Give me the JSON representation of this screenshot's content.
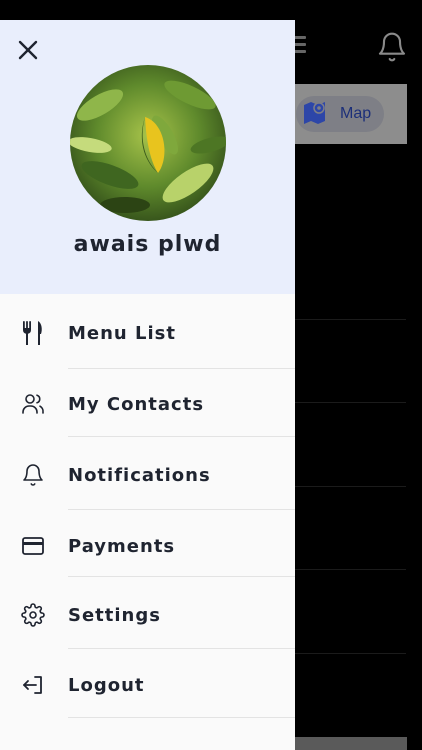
{
  "user": {
    "name": "awais plwd"
  },
  "background": {
    "map_label": "Map"
  },
  "menu": {
    "items": [
      {
        "label": "Menu List",
        "icon": "fork-knife-icon"
      },
      {
        "label": "My Contacts",
        "icon": "contacts-icon"
      },
      {
        "label": "Notifications",
        "icon": "bell-icon"
      },
      {
        "label": "Payments",
        "icon": "credit-card-icon"
      },
      {
        "label": "Settings",
        "icon": "gear-icon"
      },
      {
        "label": "Logout",
        "icon": "logout-icon"
      }
    ]
  },
  "colors": {
    "header_bg": "#e9eefc",
    "drawer_bg": "#fafafa",
    "text": "#1f2430",
    "accent": "#1c2f79"
  }
}
